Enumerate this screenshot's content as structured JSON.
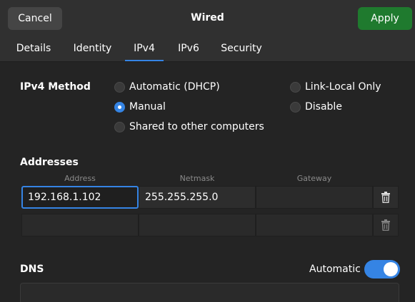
{
  "header": {
    "cancel_label": "Cancel",
    "title": "Wired",
    "apply_label": "Apply"
  },
  "tabs": [
    {
      "label": "Details"
    },
    {
      "label": "Identity"
    },
    {
      "label": "IPv4",
      "active": true
    },
    {
      "label": "IPv6"
    },
    {
      "label": "Security"
    }
  ],
  "ipv4_method": {
    "label": "IPv4 Method",
    "options": [
      {
        "label": "Automatic (DHCP)",
        "checked": false
      },
      {
        "label": "Manual",
        "checked": true
      },
      {
        "label": "Shared to other computers",
        "checked": false
      },
      {
        "label": "Link-Local Only",
        "checked": false
      },
      {
        "label": "Disable",
        "checked": false
      }
    ]
  },
  "addresses": {
    "label": "Addresses",
    "columns": [
      "Address",
      "Netmask",
      "Gateway"
    ],
    "rows": [
      {
        "address": "192.168.1.102",
        "netmask": "255.255.255.0",
        "gateway": ""
      },
      {
        "address": "",
        "netmask": "",
        "gateway": ""
      }
    ]
  },
  "dns": {
    "label": "DNS",
    "automatic_label": "Automatic",
    "automatic_on": true
  },
  "colors": {
    "accent": "#3584e4",
    "apply_button": "#1f7a2e",
    "background": "#242424",
    "headerbar": "#303030"
  },
  "icons": [
    "trash-icon",
    "trash-icon"
  ]
}
